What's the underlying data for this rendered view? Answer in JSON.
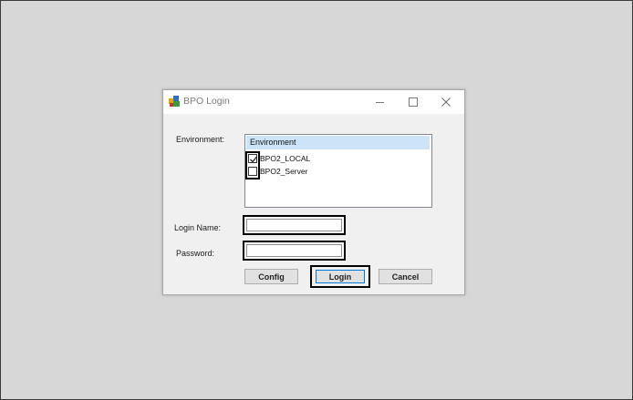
{
  "window": {
    "title": "BPO Login"
  },
  "form": {
    "environment_label": "Environment:",
    "environment_list": {
      "header": "Environment",
      "items": [
        {
          "label": "BPO2_LOCAL",
          "checked": true
        },
        {
          "label": "BPO2_Server",
          "checked": false
        }
      ]
    },
    "login_name_label": "Login Name:",
    "login_name_value": "",
    "password_label": "Password:",
    "password_value": ""
  },
  "buttons": {
    "config": "Config",
    "login": "Login",
    "cancel": "Cancel"
  },
  "colors": {
    "list_header_bg": "#cce4f7",
    "dialog_bg": "#f0f0f0",
    "desktop_bg": "#d7d7d7"
  }
}
